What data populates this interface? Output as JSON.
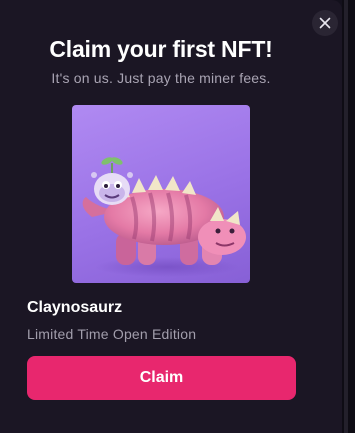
{
  "modal": {
    "title": "Claim your first NFT!",
    "subtitle": "It's on us. Just pay the miner fees.",
    "close_icon": "close-icon"
  },
  "nft": {
    "name": "Claynosaurz",
    "edition": "Limited Time Open Edition",
    "image_subject": "clay dinosaur with small creature"
  },
  "actions": {
    "claim_label": "Claim"
  },
  "colors": {
    "modal_background": "#1b1624",
    "accent": "#e8276e",
    "image_background": "#a47ded",
    "title_text": "#ffffff",
    "secondary_text": "#a9a4b3"
  }
}
